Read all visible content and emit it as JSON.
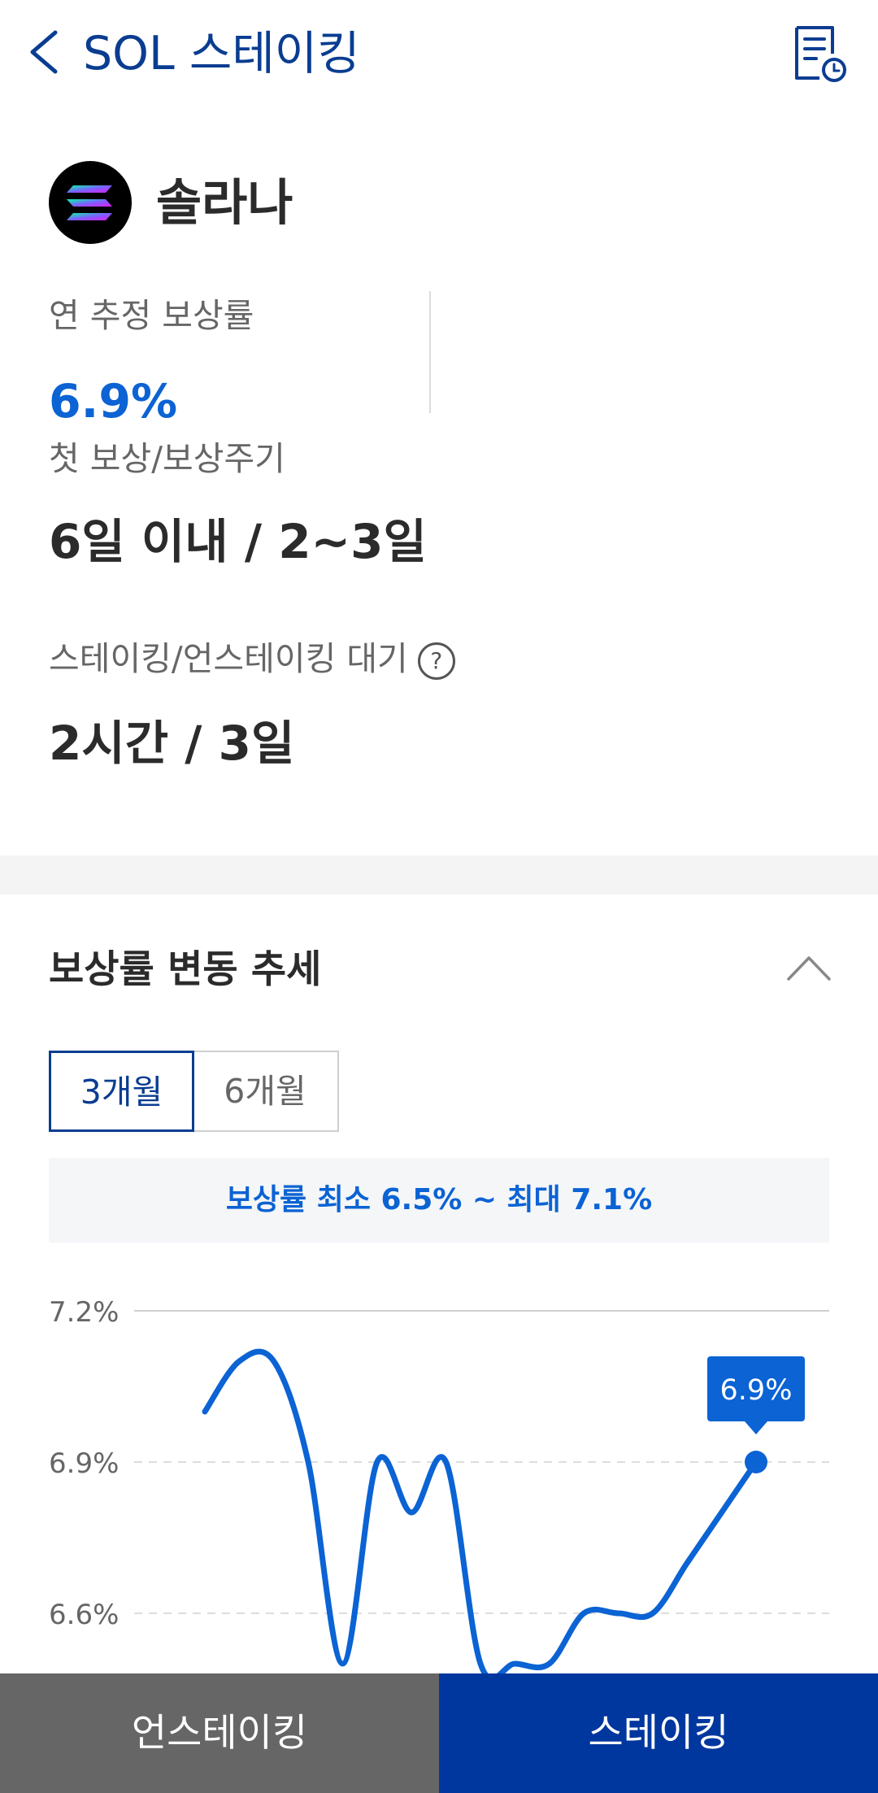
{
  "header": {
    "title": "SOL 스테이킹"
  },
  "coin": {
    "name": "솔라나"
  },
  "info": {
    "annual_rate_label": "연 추정 보상률",
    "annual_rate_value": "6.9%",
    "reward_label": "첫 보상/보상주기",
    "reward_value": "6일 이내 / 2~3일",
    "wait_label": "스테이킹/언스테이킹 대기",
    "help_glyph": "?",
    "wait_value": "2시간 / 3일"
  },
  "trend": {
    "title": "보상률 변동 추세",
    "tabs": [
      "3개월",
      "6개월"
    ],
    "selected_tab": "3개월",
    "range_text": "보상률 최소 6.5% ~ 최대 7.1%"
  },
  "chart_data": {
    "type": "line",
    "y_tick_labels": [
      "7.2%",
      "6.9%",
      "6.6%"
    ],
    "y_ticks": [
      7.2,
      6.9,
      6.6
    ],
    "ylim": [
      6.5,
      7.2
    ],
    "grid": true,
    "series": [
      {
        "x": [
          0,
          1,
          2,
          3,
          4,
          5,
          6,
          7,
          8,
          9,
          10,
          11,
          12,
          13,
          14,
          15,
          16
        ],
        "values": [
          7.0,
          7.1,
          7.1,
          6.9,
          6.5,
          6.9,
          6.8,
          6.9,
          6.5,
          6.5,
          6.5,
          6.6,
          6.6,
          6.6,
          6.7,
          6.8,
          6.9
        ]
      }
    ],
    "last_point_tooltip": "6.9%",
    "colors": {
      "line": "#0b63d4",
      "grid": "#dddddd"
    }
  },
  "bottom": {
    "unstake_label": "언스테이킹",
    "stake_label": "스테이킹"
  }
}
